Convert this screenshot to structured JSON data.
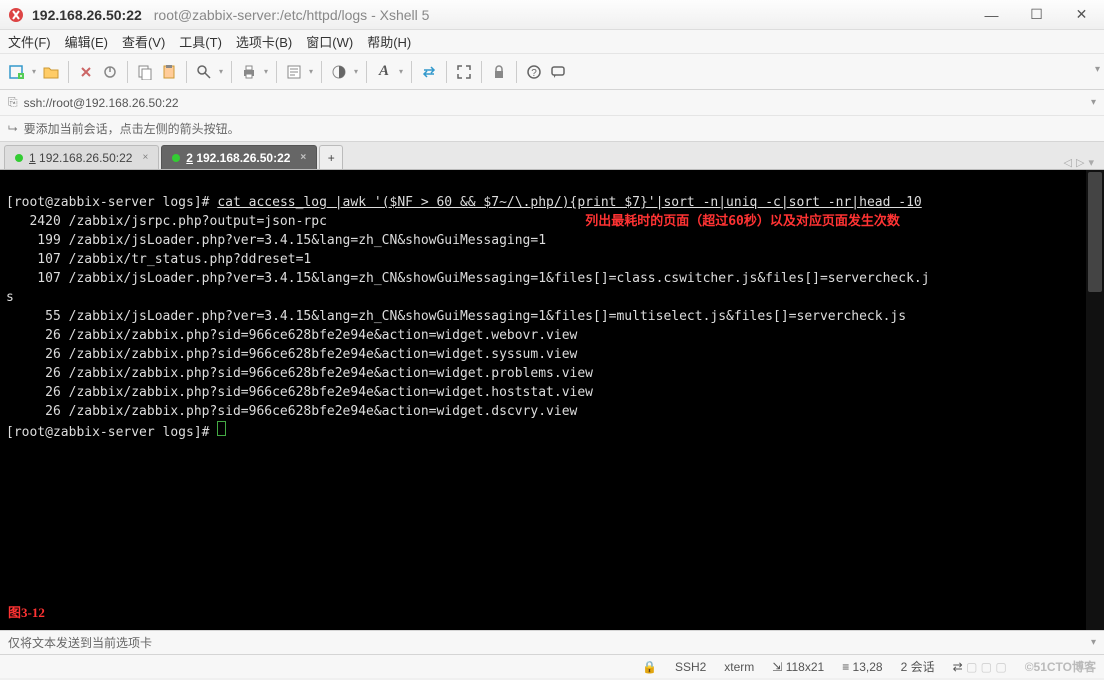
{
  "titlebar": {
    "host": "192.168.26.50:22",
    "path": "root@zabbix-server:/etc/httpd/logs - Xshell 5"
  },
  "menu": {
    "file": "文件(F)",
    "edit": "编辑(E)",
    "view": "查看(V)",
    "tools": "工具(T)",
    "tabs": "选项卡(B)",
    "window": "窗口(W)",
    "help": "帮助(H)"
  },
  "address": {
    "url": "ssh://root@192.168.26.50:22"
  },
  "hint": "要添加当前会话，点击左侧的箭头按钮。",
  "tabs": [
    {
      "num": "1",
      "label": "192.168.26.50:22",
      "active": false
    },
    {
      "num": "2",
      "label": "192.168.26.50:22",
      "active": true
    }
  ],
  "terminal": {
    "prompt": "[root@zabbix-server logs]# ",
    "command": "cat access_log |awk '($NF > 60 && $7~/\\.php/){print $7}'|sort -n|uniq -c|sort -nr|head -10",
    "annotation": "列出最耗时的页面（超过60秒）以及对应页面发生次数",
    "lines": [
      "   2420 /zabbix/jsrpc.php?output=json-rpc",
      "    199 /zabbix/jsLoader.php?ver=3.4.15&lang=zh_CN&showGuiMessaging=1",
      "    107 /zabbix/tr_status.php?ddreset=1",
      "    107 /zabbix/jsLoader.php?ver=3.4.15&lang=zh_CN&showGuiMessaging=1&files[]=class.cswitcher.js&files[]=servercheck.j",
      "s",
      "     55 /zabbix/jsLoader.php?ver=3.4.15&lang=zh_CN&showGuiMessaging=1&files[]=multiselect.js&files[]=servercheck.js",
      "     26 /zabbix/zabbix.php?sid=966ce628bfe2e94e&action=widget.webovr.view",
      "     26 /zabbix/zabbix.php?sid=966ce628bfe2e94e&action=widget.syssum.view",
      "     26 /zabbix/zabbix.php?sid=966ce628bfe2e94e&action=widget.problems.view",
      "     26 /zabbix/zabbix.php?sid=966ce628bfe2e94e&action=widget.hoststat.view",
      "     26 /zabbix/zabbix.php?sid=966ce628bfe2e94e&action=widget.dscvry.view"
    ],
    "prompt2": "[root@zabbix-server logs]# ",
    "figure": "图3-12"
  },
  "broadcast": "仅将文本发送到当前选项卡",
  "status": {
    "proto": "SSH2",
    "term": "xterm",
    "size": "118x21",
    "pos": "13,28",
    "sessions": "2 会话",
    "watermark": "©51CTO博客"
  },
  "icons": {
    "lock": "🔒",
    "resize": "⇲",
    "arrows": "⇄"
  }
}
